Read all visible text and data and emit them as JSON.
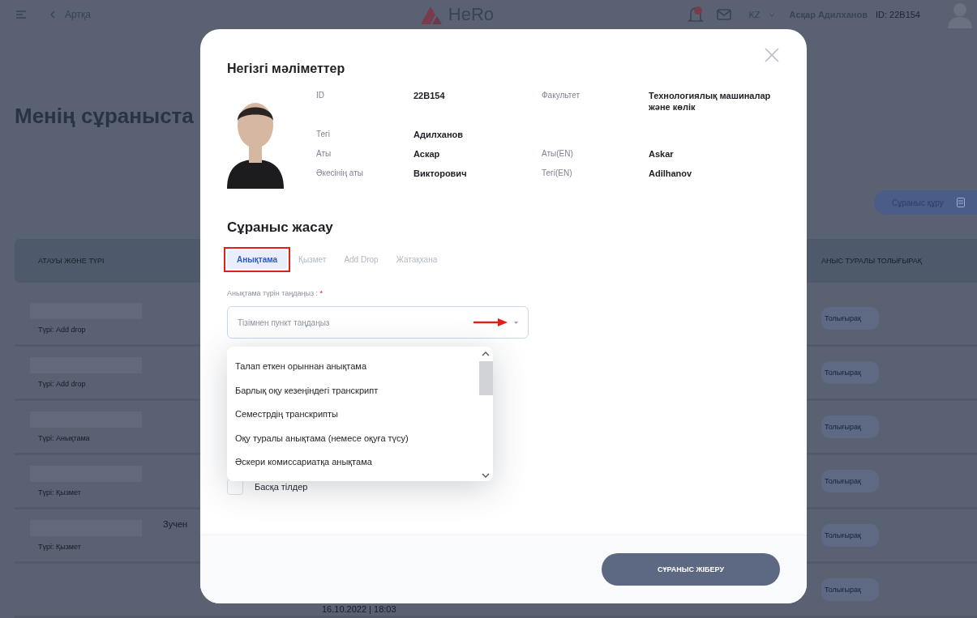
{
  "topbar": {
    "back_label": "Артқа",
    "logo": "HeRo",
    "language": "KZ",
    "user_name": "Асқар Адилханов",
    "user_id": "ID: 22B154"
  },
  "page": {
    "title": "Менің сұраныста",
    "create_button": "Сұраныс құру",
    "table": {
      "columns": [
        "АТАУЫ ЖӘНЕ ТҮРІ",
        "АНЫС ТУРАЛЫ ТОЛЫҒЫРАҚ"
      ],
      "rows": [
        {
          "type": "Түрі: Add drop",
          "details": "Толығырақ"
        },
        {
          "type": "Түрі: Add drop",
          "details": "Толығырақ"
        },
        {
          "type": "Түрі: Анықтама",
          "details": "Толығырақ"
        },
        {
          "type": "Түрі: Қызмет",
          "details": "Толығырақ"
        },
        {
          "type": "Түрі: Қызмет",
          "column_2": "Зучен",
          "details": "Толығырақ"
        },
        {
          "date": "16.10.2022 | 18:03",
          "details": "Толығырақ"
        }
      ]
    }
  },
  "modal": {
    "title": "Негізгі мәліметтер",
    "info_rows": [
      [
        {
          "label": "ID",
          "value": "22B154"
        },
        {
          "label": "Факультет",
          "value": "Технологиялық машиналар және көлік"
        }
      ],
      [
        {
          "label": "Тегі",
          "value": "Адилханов"
        }
      ],
      [
        {
          "label": "Аты",
          "value": "Аскар"
        },
        {
          "label": "Аты(EN)",
          "value": "Askar"
        }
      ],
      [
        {
          "label": "Әкесінің аты",
          "value": "Викторович"
        },
        {
          "label": "Тегі(EN)",
          "value": "Adilhanov"
        }
      ]
    ],
    "section_title": "Сұраныс жасау",
    "tabs": [
      {
        "label": "Анықтама",
        "selected": true,
        "highlighted": true
      },
      {
        "label": "Қызмет",
        "selected": false,
        "highlighted": false
      },
      {
        "label": "Add Drop",
        "selected": false,
        "highlighted": false
      },
      {
        "label": "Жатақхана",
        "selected": false,
        "highlighted": false
      }
    ],
    "select": {
      "label": "Анықтама түрін таңдаңыз :",
      "required_mark": "*",
      "placeholder": "Тізімнен пункт таңдаңыз",
      "pointer_arrow": true,
      "expanded": true,
      "options": [
        "Талап еткен орыннан анықтама",
        "Барлық оқу кезеңіндегі транскрипт",
        "Семестрдің транскрипты",
        "Оқу туралы анықтама (немесе оқуға түсу)",
        "Әскери комиссариатқа анықтама"
      ]
    },
    "checkbox": {
      "label": "Басқа тілдер",
      "checked": false
    },
    "submit": "СҰРАНЫС ЖІБЕРУ"
  }
}
